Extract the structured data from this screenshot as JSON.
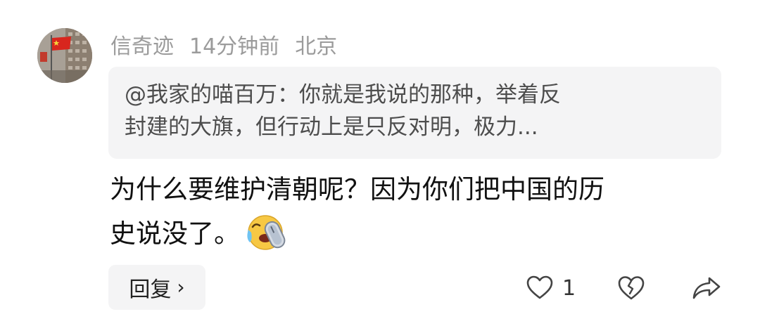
{
  "comment": {
    "avatar_icon": "flag-avatar-icon",
    "username": "信奇迹",
    "time": "14分钟前",
    "location": "北京",
    "quote": {
      "line1": "@我家的喵百万：你就是我说的那种，举着反",
      "line2": "封建的大旗，但行动上是只反对明，极力..."
    },
    "content": {
      "line1": "为什么要维护清朝呢？因为你们把中国的历",
      "line2": "史说没了。",
      "emoji": "crying-laughing-emoji-icon"
    },
    "reply_label": "回复",
    "reply_chevron": "›",
    "like_count": "1",
    "icons": {
      "like": "heart-icon",
      "dislike": "broken-heart-icon",
      "share": "share-arrow-icon"
    },
    "colors": {
      "meta_text": "#9b9b9b",
      "quote_bg": "#f4f4f5",
      "emoji_yellow": "#f7c844"
    }
  }
}
